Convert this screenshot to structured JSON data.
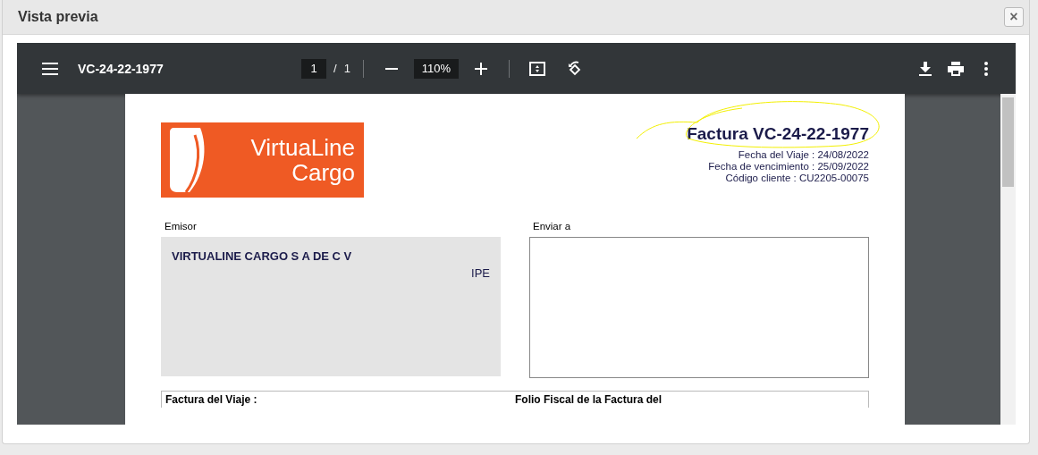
{
  "dialog": {
    "title": "Vista previa",
    "close": "×"
  },
  "viewer": {
    "file_name": "VC-24-22-1977",
    "page": "1",
    "separator": "/",
    "page_count": "1",
    "zoom": "110%"
  },
  "document": {
    "logo": {
      "line_1": "VirtuaLine",
      "line_2": "Cargo"
    },
    "title": "Factura VC-24-22-1977",
    "meta": [
      "Fecha del Viaje : 24/08/2022",
      "Fecha de vencimiento : 25/09/2022",
      "Código cliente : CU2205-00075"
    ],
    "sender": {
      "label": "Emisor",
      "name": "VIRTUALINE CARGO S A DE C V",
      "fragment": "IPE"
    },
    "recipient": {
      "label": "Enviar a"
    },
    "table_headers": [
      "Factura del Viaje :",
      "Folio Fiscal de la Factura del"
    ]
  }
}
